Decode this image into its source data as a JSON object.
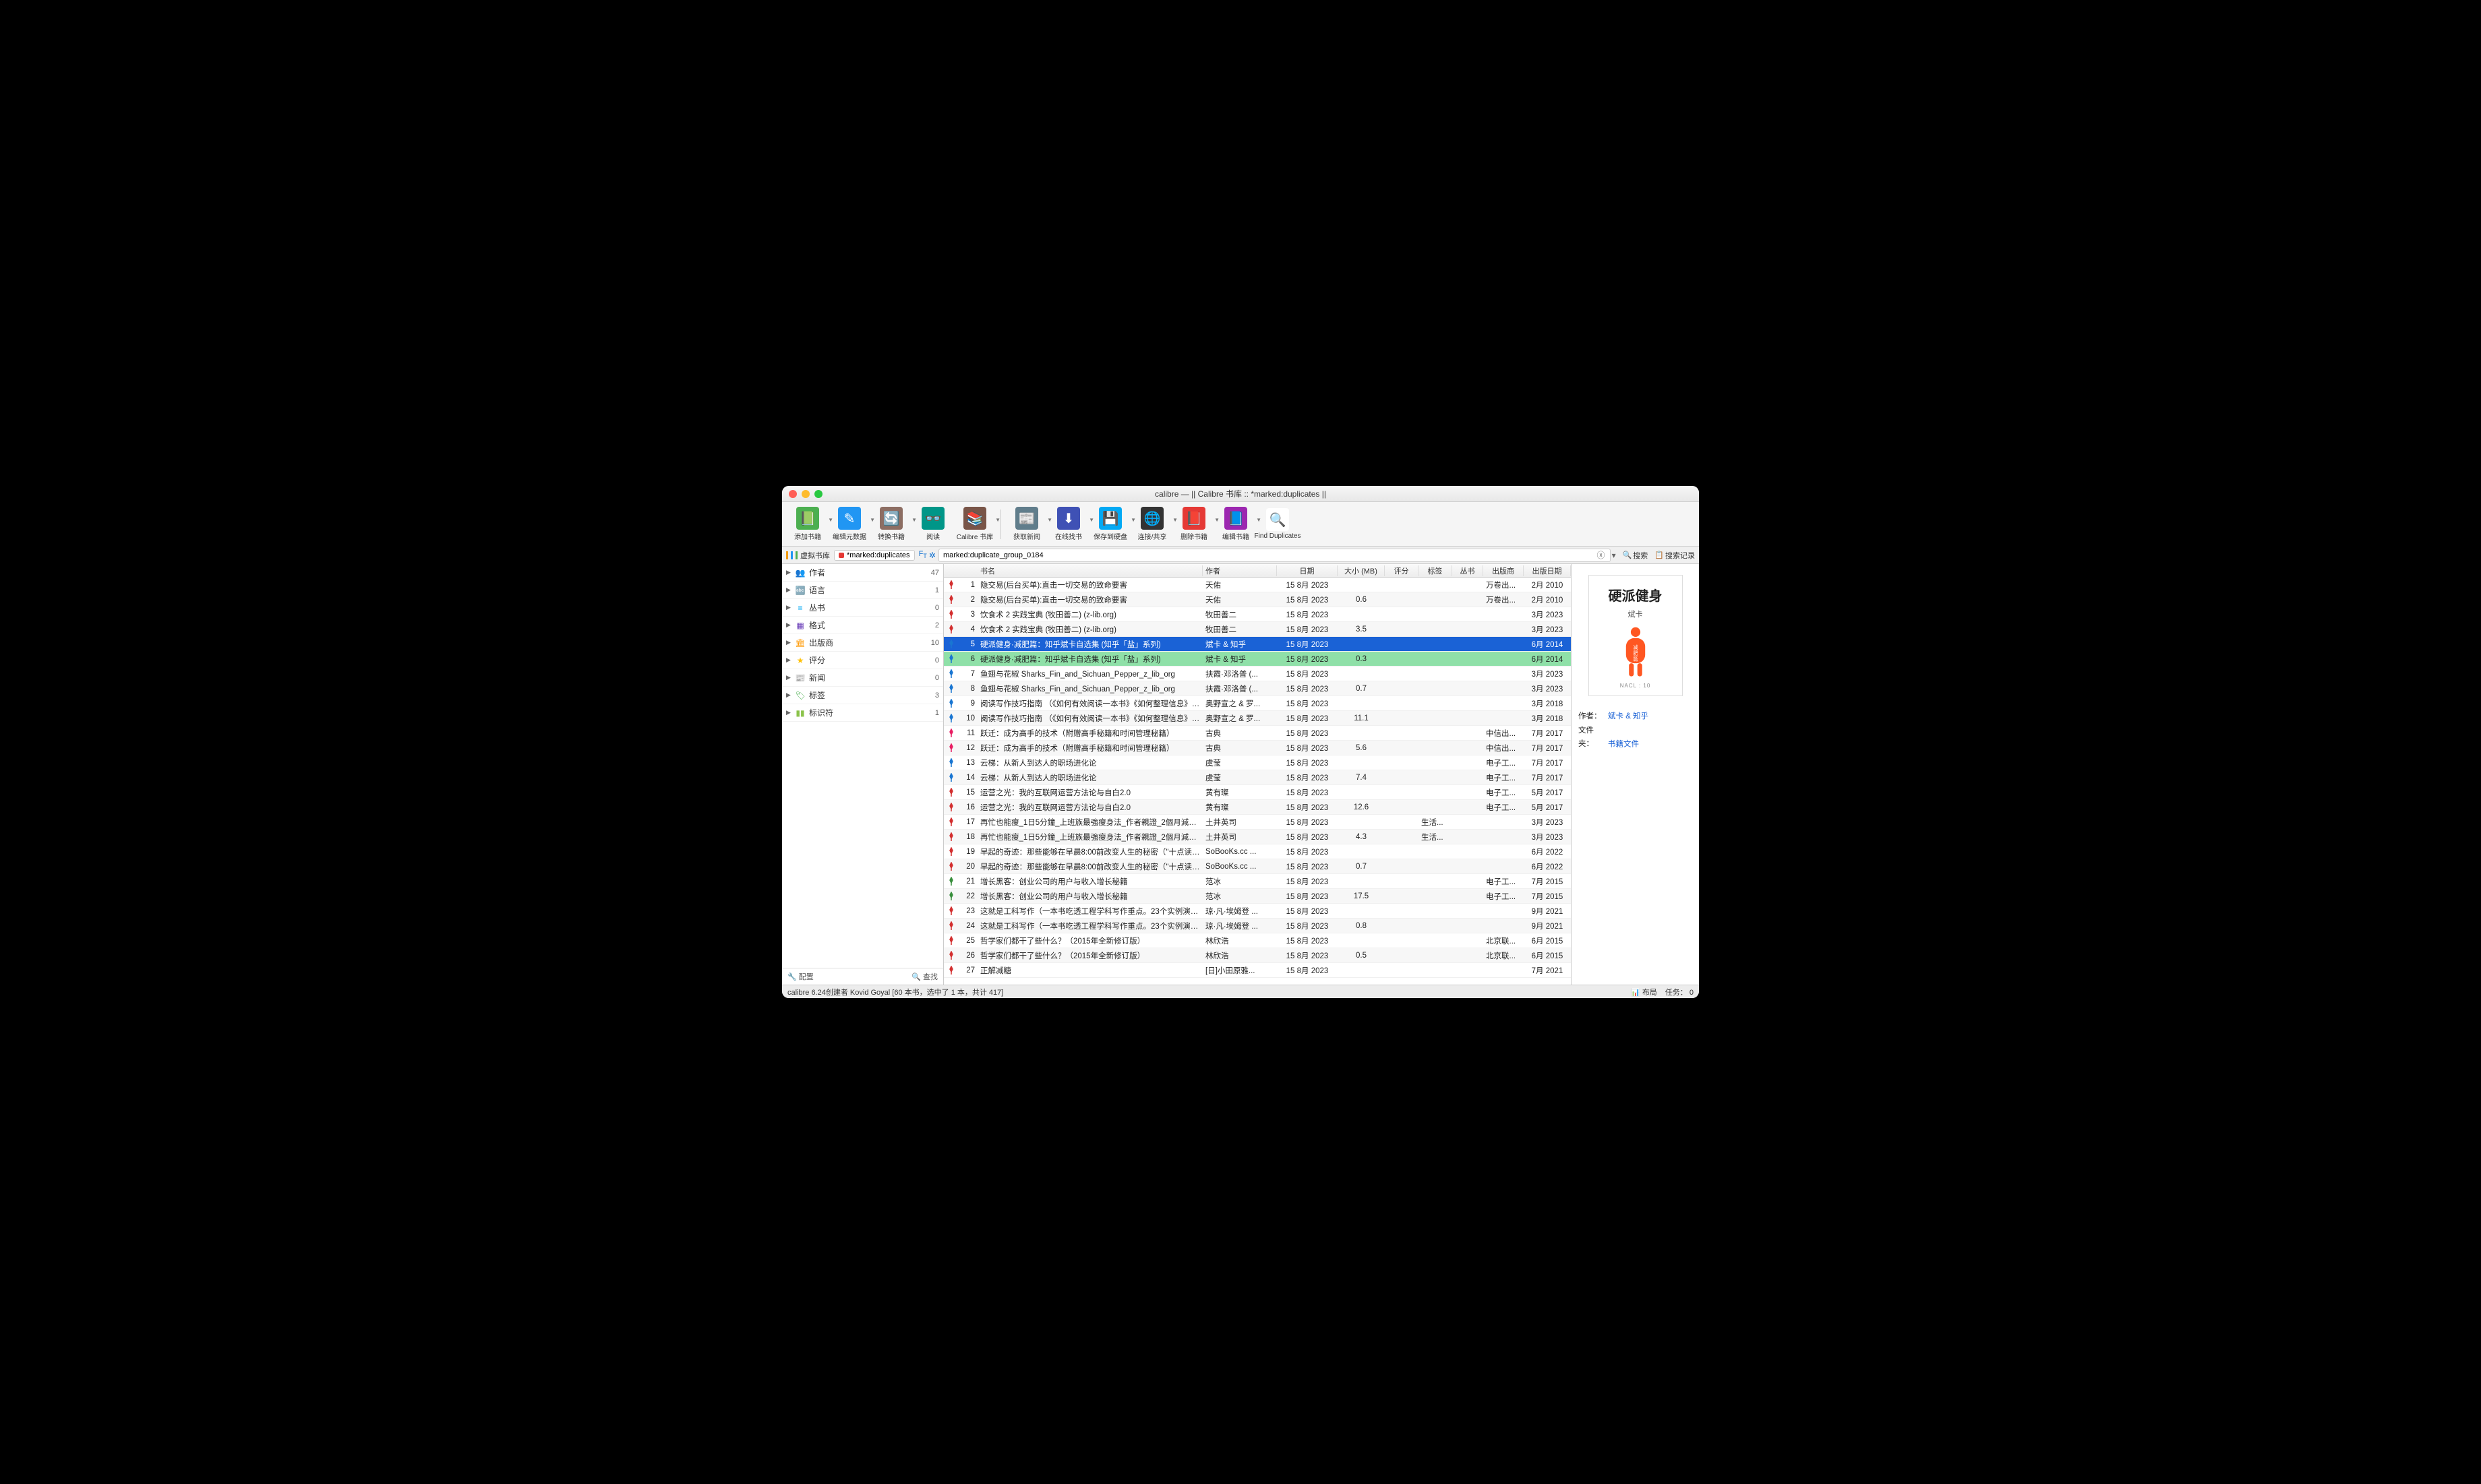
{
  "title": "calibre — || Calibre 书库 :: *marked:duplicates ||",
  "toolbar": [
    {
      "label": "添加书籍",
      "icon": "add",
      "color": "#4caf50",
      "drop": true
    },
    {
      "label": "编辑元数据",
      "icon": "edit",
      "color": "#2196f3",
      "drop": true
    },
    {
      "label": "转换书籍",
      "icon": "convert",
      "color": "#8d6e63",
      "drop": true
    },
    {
      "label": "阅读",
      "icon": "glasses",
      "color": "#009688"
    },
    {
      "label": "Calibre 书库",
      "icon": "library",
      "color": "#795548",
      "drop": true
    },
    {
      "sep": true
    },
    {
      "label": "获取新闻",
      "icon": "news",
      "color": "#607d8b",
      "drop": true
    },
    {
      "label": "在线找书",
      "icon": "download",
      "color": "#3f51b5",
      "drop": true
    },
    {
      "label": "保存到硬盘",
      "icon": "save",
      "color": "#03a9f4",
      "drop": true
    },
    {
      "label": "连接/共享",
      "icon": "share",
      "color": "#333",
      "drop": true
    },
    {
      "label": "删除书籍",
      "icon": "delete",
      "color": "#e53935",
      "drop": true
    },
    {
      "label": "编辑书籍",
      "icon": "editbook",
      "color": "#9c27b0",
      "drop": true
    },
    {
      "label": "Find Duplicates",
      "icon": "find",
      "color": "#fff"
    }
  ],
  "searchrow": {
    "vlib": "虚拟书库",
    "pill": "*marked:duplicates",
    "query": "marked:duplicate_group_0184",
    "search": "搜索",
    "history": "搜索记录"
  },
  "sidebar": [
    {
      "icon": "👥",
      "label": "作者",
      "count": 47,
      "color": "#1976d2"
    },
    {
      "icon": "🔤",
      "label": "语言",
      "count": 1,
      "color": "#e91e63"
    },
    {
      "icon": "≡",
      "label": "丛书",
      "count": 0,
      "color": "#03a9f4"
    },
    {
      "icon": "▦",
      "label": "格式",
      "count": 2,
      "color": "#673ab7"
    },
    {
      "icon": "🏛",
      "label": "出版商",
      "count": 10,
      "color": "#ff9800"
    },
    {
      "icon": "★",
      "label": "评分",
      "count": 0,
      "color": "#ffc107"
    },
    {
      "icon": "📰",
      "label": "新闻",
      "count": 0,
      "color": "#607d8b"
    },
    {
      "icon": "🏷",
      "label": "标签",
      "count": 3,
      "color": "#4caf50"
    },
    {
      "icon": "▮▮",
      "label": "标识符",
      "count": 1,
      "color": "#8bc34a"
    }
  ],
  "sbfoot": {
    "config": "配置",
    "find": "查找"
  },
  "columns": [
    "",
    "",
    "书名",
    "作者",
    "日期",
    "大小 (MB)",
    "评分",
    "标签",
    "丛书",
    "出版商",
    "出版日期"
  ],
  "rows": [
    {
      "n": 1,
      "pin": "r",
      "title": "隐交易(后台买单):直击一切交易的致命要害",
      "auth": "天佑",
      "date": "15 8月 2023",
      "size": "",
      "pub": "万卷出...",
      "pubd": "2月 2010"
    },
    {
      "n": 2,
      "pin": "r",
      "title": "隐交易(后台买单):直击一切交易的致命要害",
      "auth": "天佑",
      "date": "15 8月 2023",
      "size": "0.6",
      "pub": "万卷出...",
      "pubd": "2月 2010"
    },
    {
      "n": 3,
      "pin": "r",
      "title": "饮食术 2 实践宝典 (牧田善二) (z-lib.org)",
      "auth": "牧田善二",
      "date": "15 8月 2023",
      "size": "",
      "pub": "",
      "pubd": "3月 2023"
    },
    {
      "n": 4,
      "pin": "r",
      "title": "饮食术 2 实践宝典 (牧田善二) (z-lib.org)",
      "auth": "牧田善二",
      "date": "15 8月 2023",
      "size": "3.5",
      "pub": "",
      "pubd": "3月 2023"
    },
    {
      "n": 5,
      "pin": "b",
      "title": "硬派健身·减肥篇：知乎斌卡自选集 (知乎「盐」系列)",
      "auth": "斌卡 & 知乎",
      "date": "15 8月 2023",
      "size": "",
      "pub": "",
      "pubd": "6月 2014",
      "sel": 1
    },
    {
      "n": 6,
      "pin": "b",
      "title": "硬派健身·减肥篇：知乎斌卡自选集 (知乎「盐」系列)",
      "auth": "斌卡 & 知乎",
      "date": "15 8月 2023",
      "size": "0.3",
      "pub": "",
      "pubd": "6月 2014",
      "sel": 2
    },
    {
      "n": 7,
      "pin": "b",
      "title": "鱼翅与花椒 Sharks_Fin_and_Sichuan_Pepper_z_lib_org",
      "auth": "扶霞·邓洛普 (...",
      "date": "15 8月 2023",
      "size": "",
      "pub": "",
      "pubd": "3月 2023"
    },
    {
      "n": 8,
      "pin": "b",
      "title": "鱼翅与花椒 Sharks_Fin_and_Sichuan_Pepper_z_lib_org",
      "auth": "扶霞·邓洛普 (...",
      "date": "15 8月 2023",
      "size": "0.7",
      "pub": "",
      "pubd": "3月 2023"
    },
    {
      "n": 9,
      "pin": "b",
      "title": "阅读写作技巧指南 （《如何有效阅读一本书》《如何整理信息》《文案创...",
      "auth": "奥野宣之 & 罗...",
      "date": "15 8月 2023",
      "size": "",
      "pub": "",
      "pubd": "3月 2018"
    },
    {
      "n": 10,
      "pin": "b",
      "title": "阅读写作技巧指南 （《如何有效阅读一本书》《如何整理信息》《文案创...",
      "auth": "奥野宣之 & 罗...",
      "date": "15 8月 2023",
      "size": "11.1",
      "pub": "",
      "pubd": "3月 2018"
    },
    {
      "n": 11,
      "pin": "p",
      "title": "跃迁：成为高手的技术（附赠高手秘籍和时间管理秘籍）",
      "auth": "古典",
      "date": "15 8月 2023",
      "size": "",
      "pub": "中信出...",
      "pubd": "7月 2017"
    },
    {
      "n": 12,
      "pin": "p",
      "title": "跃迁：成为高手的技术（附赠高手秘籍和时间管理秘籍）",
      "auth": "古典",
      "date": "15 8月 2023",
      "size": "5.6",
      "pub": "中信出...",
      "pubd": "7月 2017"
    },
    {
      "n": 13,
      "pin": "b",
      "title": "云梯：从新人到达人的职场进化论",
      "auth": "虞莹",
      "date": "15 8月 2023",
      "size": "",
      "pub": "电子工...",
      "pubd": "7月 2017"
    },
    {
      "n": 14,
      "pin": "b",
      "title": "云梯：从新人到达人的职场进化论",
      "auth": "虞莹",
      "date": "15 8月 2023",
      "size": "7.4",
      "pub": "电子工...",
      "pubd": "7月 2017"
    },
    {
      "n": 15,
      "pin": "r",
      "title": "运营之光：我的互联网运营方法论与自白2.0",
      "auth": "黄有璨",
      "date": "15 8月 2023",
      "size": "",
      "pub": "电子工...",
      "pubd": "5月 2017"
    },
    {
      "n": 16,
      "pin": "r",
      "title": "运营之光：我的互联网运营方法论与自白2.0",
      "auth": "黄有璨",
      "date": "15 8月 2023",
      "size": "12.6",
      "pub": "电子工...",
      "pubd": "5月 2017"
    },
    {
      "n": 17,
      "pin": "r",
      "title": "再忙也能瘦_1日5分鐘_上班族最強瘦身法_作者親證_2個月減去16公斤的...",
      "auth": "土井英司",
      "date": "15 8月 2023",
      "size": "",
      "tag": "生活...",
      "pub": "",
      "pubd": "3月 2023"
    },
    {
      "n": 18,
      "pin": "r",
      "title": "再忙也能瘦_1日5分鐘_上班族最強瘦身法_作者親證_2個月減去16公斤的...",
      "auth": "土井英司",
      "date": "15 8月 2023",
      "size": "4.3",
      "tag": "生活...",
      "pub": "",
      "pubd": "3月 2023"
    },
    {
      "n": 19,
      "pin": "r",
      "title": "早起的奇迹：那些能够在早晨8:00前改变人生的秘密（\"十点读书\"爆款课...",
      "auth": "SoBooKs.cc ...",
      "date": "15 8月 2023",
      "size": "",
      "pub": "",
      "pubd": "6月 2022"
    },
    {
      "n": 20,
      "pin": "r",
      "title": "早起的奇迹：那些能够在早晨8:00前改变人生的秘密（\"十点读书\"爆款课...",
      "auth": "SoBooKs.cc ...",
      "date": "15 8月 2023",
      "size": "0.7",
      "pub": "",
      "pubd": "6月 2022"
    },
    {
      "n": 21,
      "pin": "g",
      "title": "增长黑客：创业公司的用户与收入增长秘籍",
      "auth": "范冰",
      "date": "15 8月 2023",
      "size": "",
      "pub": "电子工...",
      "pubd": "7月 2015"
    },
    {
      "n": 22,
      "pin": "g",
      "title": "增长黑客：创业公司的用户与收入增长秘籍",
      "auth": "范冰",
      "date": "15 8月 2023",
      "size": "17.5",
      "pub": "电子工...",
      "pubd": "7月 2015"
    },
    {
      "n": 23,
      "pin": "r",
      "title": "这就是工科写作（一本书吃透工程学科写作重点。23个实例演练，82条...",
      "auth": "琼·凡·埃姆登 ...",
      "date": "15 8月 2023",
      "size": "",
      "pub": "",
      "pubd": "9月 2021"
    },
    {
      "n": 24,
      "pin": "r",
      "title": "这就是工科写作（一本书吃透工程学科写作重点。23个实例演练，82条...",
      "auth": "琼·凡·埃姆登 ...",
      "date": "15 8月 2023",
      "size": "0.8",
      "pub": "",
      "pubd": "9月 2021"
    },
    {
      "n": 25,
      "pin": "r",
      "title": "哲学家们都干了些什么？（2015年全新修订版）",
      "auth": "林欣浩",
      "date": "15 8月 2023",
      "size": "",
      "pub": "北京联...",
      "pubd": "6月 2015"
    },
    {
      "n": 26,
      "pin": "r",
      "title": "哲学家们都干了些什么？（2015年全新修订版）",
      "auth": "林欣浩",
      "date": "15 8月 2023",
      "size": "0.5",
      "pub": "北京联...",
      "pubd": "6月 2015"
    },
    {
      "n": 27,
      "pin": "r",
      "title": "正解减糖",
      "auth": "[日]小田原雅...",
      "date": "15 8月 2023",
      "size": "",
      "pub": "",
      "pubd": "7月 2021"
    }
  ],
  "detail": {
    "title": "硬派健身",
    "sub": "斌卡",
    "chars": "减肥篇",
    "nacl": "NACL : 10",
    "meta": [
      {
        "label": "作者：",
        "value": "斌卡 & 知乎",
        "link": true
      },
      {
        "label": "文件夹：",
        "value": "书籍文件",
        "link": true
      }
    ]
  },
  "status": {
    "left": "calibre 6.24创建者 Kovid Goyal   [60 本书，选中了 1 本，共计 417]",
    "layout": "布局",
    "jobs": "任务：  0"
  }
}
